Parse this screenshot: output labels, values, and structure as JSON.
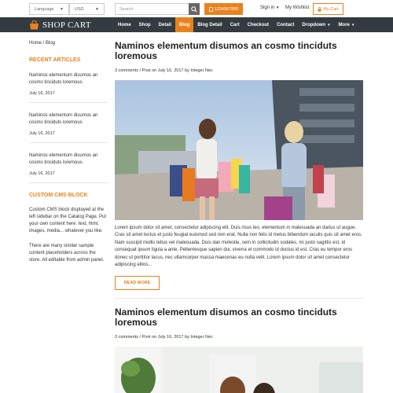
{
  "topbar": {
    "language": "Language",
    "currency": "USD",
    "search_placeholder": "Search",
    "phone": "1234567890",
    "sign_in": "Sign in",
    "wishlist": "My Wishlist",
    "cart": "My Cart"
  },
  "brand": {
    "name": "SHOP CART",
    "accent": "#e8821e",
    "nav_bg": "#333a40"
  },
  "nav": {
    "items": [
      "Home",
      "Shop",
      "Detail",
      "Blog",
      "Blog Detail",
      "Cart",
      "Checkout",
      "Contact",
      "Dropdown",
      "More"
    ],
    "active": "Blog"
  },
  "sidebar": {
    "breadcrumb": "Home / Blog",
    "recent_title": "RECENT ARTICLES",
    "articles": [
      {
        "title": "Naminos elementum disumos an cosmo tinciduts loremous",
        "date": "July 16, 2017"
      },
      {
        "title": "Naminos elementum disumos an cosmo tinciduts loremous",
        "date": "July 16, 2017"
      },
      {
        "title": "Naminos elementum disumos an cosmo tinciduts loremous",
        "date": "July 16, 2017"
      }
    ],
    "cms_title": "CUSTOM CMS BLOCK",
    "cms_p1": "Custom CMS block displayed at the left sidebar on the Catalog Page. Put your own content here: text, html, images, media... whatever you like.",
    "cms_p2": "There are many similar sample content placeholders across the store. All editable from admin panel."
  },
  "posts": [
    {
      "title": "Naminos elementum disumos an cosmo tinciduts loremous",
      "comments": "3 comments",
      "posted": " / Post on July 16, 2017 by ",
      "author": "Integer Nec",
      "excerpt": "Lorem ipsum dolor sit amet, consectetur adipiscing elit. Duis risus leo, elementum in malesuada an darius ut augue. Cras sit amet lectus et justo feugiat euismod sed non erat. Nulla non felis id metus bibendum iaculis quis sit amet eros. Nam suscipit mollis tellus vel malesuada. Duis dan molestie, sem in sollicitudin sodales, mi justo sagittis est, id consequat ipsum ligula a ante. Pellentesque sapien dui, viverra et commodo id ductus id est. Cras eu tempor eros donec ut porttitor lacus, nec ullamcorper massa maecenas eu nulla velit. Lorem ipsum dolor sit amet consectetur adipiscing elitos...",
      "read_more": "READ MORE"
    },
    {
      "title": "Naminos elementum disumos an cosmo tinciduts loremous",
      "comments": "3 comments",
      "posted": " / Post on July 16, 2017 by ",
      "author": "Integer Nec"
    }
  ]
}
